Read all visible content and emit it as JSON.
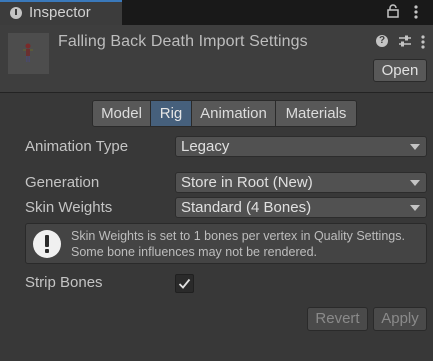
{
  "window": {
    "tab_label": "Inspector",
    "tab_icon": "info-icon",
    "lock_icon": "lock-icon",
    "menu_icon": "kebab-menu-icon"
  },
  "header": {
    "title": "Falling Back Death Import Settings",
    "thumbnail_icon": "animation-clip-thumbnail-icon",
    "help_icon_glyph": "?",
    "open_label": "Open"
  },
  "tabs": {
    "items": [
      {
        "label": "Model",
        "active": false
      },
      {
        "label": "Rig",
        "active": true
      },
      {
        "label": "Animation",
        "active": false
      },
      {
        "label": "Materials",
        "active": false
      }
    ]
  },
  "rig": {
    "animation_type": {
      "label": "Animation Type",
      "value": "Legacy"
    },
    "generation": {
      "label": "Generation",
      "value": "Store in Root (New)"
    },
    "skin_weights": {
      "label": "Skin Weights",
      "value": "Standard (4 Bones)"
    },
    "warning": {
      "icon": "warning-exclamation-icon",
      "text": "Skin Weights is set to 1 bones per vertex in Quality Settings. Some bone influences may not be rendered."
    },
    "strip_bones": {
      "label": "Strip Bones",
      "checked": true
    }
  },
  "footer": {
    "revert_label": "Revert",
    "apply_label": "Apply"
  },
  "colors": {
    "accent_tab": "#3a79bb",
    "active_segment": "#46607c",
    "background": "#383838"
  }
}
